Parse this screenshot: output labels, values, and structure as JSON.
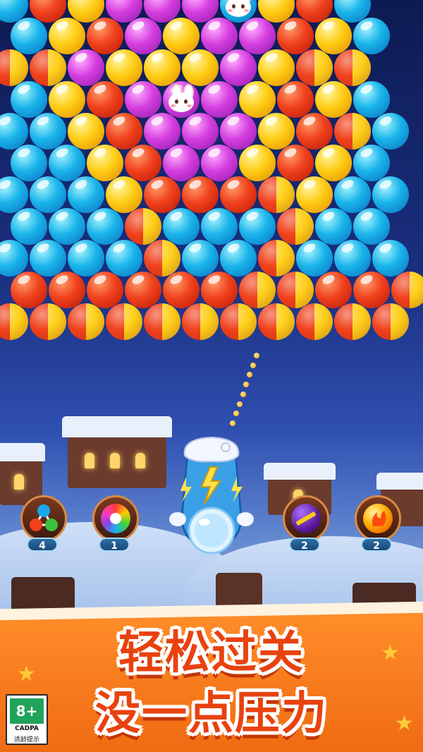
{
  "colors": {
    "red": "#f0411c",
    "yellow": "#ffcc14",
    "purple": "#d63ee0",
    "blue": "#19b4ea",
    "banner_orange": "#f57a1c",
    "banner_text": "#e8420f"
  },
  "board": {
    "rows": [
      "BRYPPPBYRB",
      "BYRPYPPRYB",
      "SSPYYYPYSS",
      "BYRPPPYRYB",
      "BBYRPPPYRSB",
      "BBYRPPYRYB",
      "BBBYRRRSYBB",
      "BBBSBBBSBB",
      "BBBBSBBSBBB",
      "RRRRRRSSRRS",
      "SSSSSSSSSSS"
    ],
    "row_offsets": [
      0,
      1,
      0,
      1,
      0,
      1,
      0,
      1,
      0,
      1,
      0
    ],
    "legend": {
      "R": "red",
      "Y": "yellow",
      "P": "purple",
      "B": "blue",
      "S": "red-yellow swirl"
    },
    "special_bubbles": [
      {
        "kind": "bunny",
        "row": 0,
        "col": 6
      },
      {
        "kind": "bunny",
        "row": 3,
        "col": 4
      }
    ]
  },
  "aim": {
    "dots": 8
  },
  "cannon": {
    "icon": "lightning-bubble-launcher-icon",
    "current_bubble": "white-blue"
  },
  "boosters": [
    {
      "name": "tri-color-bubble",
      "icon": "tri-color-molecule-icon",
      "count": "4"
    },
    {
      "name": "rainbow-bubble",
      "icon": "rainbow-ball-icon",
      "count": "1"
    },
    {
      "name": "bomb",
      "icon": "bomb-icon",
      "count": "2"
    },
    {
      "name": "fireball",
      "icon": "fireball-icon",
      "count": "2"
    }
  ],
  "banner": {
    "line1": "轻松过关",
    "line2": "没一点压力"
  },
  "age_rating": {
    "rating": "8+",
    "org": "CADPA",
    "label": "适龄提示"
  }
}
